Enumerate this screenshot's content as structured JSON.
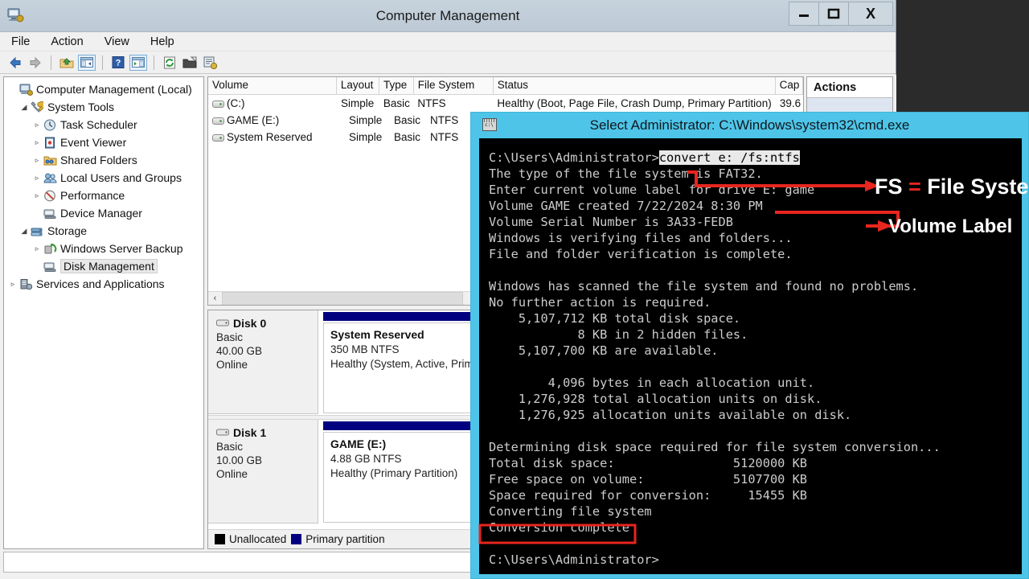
{
  "window": {
    "title": "Computer Management",
    "icon": "computer-management-icon",
    "buttons": {
      "minimize": "—",
      "maximize": "❑",
      "close": "X"
    }
  },
  "menu": {
    "items": [
      "File",
      "Action",
      "View",
      "Help"
    ]
  },
  "toolbar": {
    "items": [
      "back-arrow-icon",
      "forward-arrow-icon",
      "up-folder-icon",
      "show-hide-console-tree-icon",
      "help-icon",
      "show-hide-action-pane-icon",
      "refresh-icon",
      "export-list-icon",
      "properties-icon"
    ]
  },
  "tree": {
    "items": [
      {
        "label": "Computer Management (Local)",
        "indent": 0,
        "expander": "",
        "icon": "computer-icon",
        "selected": false
      },
      {
        "label": "System Tools",
        "indent": 1,
        "expander": "◢",
        "icon": "system-tools-icon",
        "selected": false
      },
      {
        "label": "Task Scheduler",
        "indent": 2,
        "expander": "▹",
        "icon": "clock-icon",
        "selected": false
      },
      {
        "label": "Event Viewer",
        "indent": 2,
        "expander": "▹",
        "icon": "event-viewer-icon",
        "selected": false
      },
      {
        "label": "Shared Folders",
        "indent": 2,
        "expander": "▹",
        "icon": "shared-folders-icon",
        "selected": false
      },
      {
        "label": "Local Users and Groups",
        "indent": 2,
        "expander": "▹",
        "icon": "users-icon",
        "selected": false
      },
      {
        "label": "Performance",
        "indent": 2,
        "expander": "▹",
        "icon": "performance-icon",
        "selected": false
      },
      {
        "label": "Device Manager",
        "indent": 2,
        "expander": "",
        "icon": "device-manager-icon",
        "selected": false
      },
      {
        "label": "Storage",
        "indent": 1,
        "expander": "◢",
        "icon": "storage-icon",
        "selected": false
      },
      {
        "label": "Windows Server Backup",
        "indent": 2,
        "expander": "▹",
        "icon": "backup-icon",
        "selected": false
      },
      {
        "label": "Disk Management",
        "indent": 2,
        "expander": "",
        "icon": "disk-management-icon",
        "selected": true
      },
      {
        "label": "Services and Applications",
        "indent": 1,
        "expander": "▹",
        "icon": "services-icon",
        "selected": false
      }
    ]
  },
  "volume_list": {
    "columns": [
      "Volume",
      "Layout",
      "Type",
      "File System",
      "Status",
      "Cap"
    ],
    "rows": [
      {
        "volume": "(C:)",
        "layout": "Simple",
        "type": "Basic",
        "file_system": "NTFS",
        "status": "Healthy (Boot, Page File, Crash Dump, Primary Partition)",
        "capacity": "39.6"
      },
      {
        "volume": "GAME (E:)",
        "layout": "Simple",
        "type": "Basic",
        "file_system": "NTFS",
        "status": "",
        "capacity": ""
      },
      {
        "volume": "System Reserved",
        "layout": "Simple",
        "type": "Basic",
        "file_system": "NTFS",
        "status": "",
        "capacity": ""
      }
    ],
    "scrollbar": {
      "left_arrow": "‹",
      "grip": "‖‖"
    }
  },
  "disk_view": {
    "disks": [
      {
        "name": "Disk 0",
        "kind": "Basic",
        "size": "40.00 GB",
        "state": "Online",
        "partition": {
          "name": "System Reserved",
          "size_fs": "350 MB NTFS",
          "status": "Healthy (System, Active, Prim"
        }
      },
      {
        "name": "Disk 1",
        "kind": "Basic",
        "size": "10.00 GB",
        "state": "Online",
        "partition": {
          "name": "GAME  (E:)",
          "size_fs": "4.88 GB NTFS",
          "status": "Healthy (Primary Partition)"
        }
      }
    ],
    "legend": [
      {
        "label": "Unallocated",
        "color": "#000000"
      },
      {
        "label": "Primary partition",
        "color": "#000080"
      }
    ]
  },
  "actions_pane": {
    "title": "Actions"
  },
  "cmd": {
    "title": "Select Administrator: C:\\Windows\\system32\\cmd.exe",
    "icon": "cmd-window-icon",
    "prompt_line": "C:\\Users\\Administrator>",
    "highlighted_command": "convert e: /fs:ntfs",
    "lines": [
      "The type of the file system is FAT32.",
      "Enter current volume label for drive E: game",
      "Volume GAME created 7/22/2024 8:30 PM",
      "Volume Serial Number is 3A33-FEDB",
      "Windows is verifying files and folders...",
      "File and folder verification is complete.",
      "",
      "Windows has scanned the file system and found no problems.",
      "No further action is required.",
      "    5,107,712 KB total disk space.",
      "            8 KB in 2 hidden files.",
      "    5,107,700 KB are available.",
      "",
      "        4,096 bytes in each allocation unit.",
      "    1,276,928 total allocation units on disk.",
      "    1,276,925 allocation units available on disk.",
      "",
      "Determining disk space required for file system conversion...",
      "Total disk space:                5120000 KB",
      "Free space on volume:            5107700 KB",
      "Space required for conversion:     15455 KB",
      "Converting file system",
      "Conversion complete",
      "",
      "C:\\Users\\Administrator>"
    ],
    "final_prompt": "C:\\Users\\Administrator>"
  },
  "annotations": {
    "fs_label_prefix": "FS ",
    "fs_label_eq": "=",
    "fs_label_suffix": " File System",
    "volume_label": "Volume  Label",
    "highlight_box_target": "Conversion complete",
    "arrow_color": "#e8251f"
  },
  "colors": {
    "desktop": "#2b2b2b",
    "cmd_titlebar": "#4ec5e8",
    "console_bg": "#000000",
    "console_fg": "#cccccc",
    "annotation_red": "#e8251f",
    "primary_partition": "#000080"
  }
}
